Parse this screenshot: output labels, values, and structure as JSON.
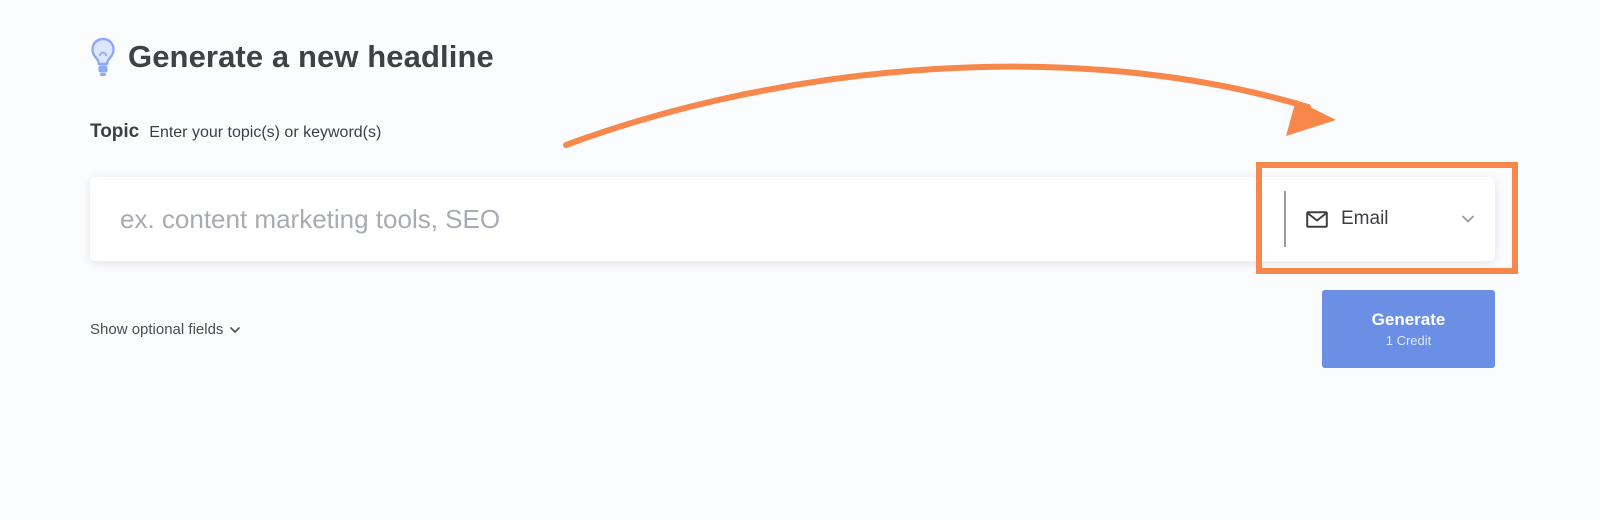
{
  "header": {
    "title": "Generate a new headline",
    "icon": "lightbulb-icon"
  },
  "topic": {
    "label": "Topic",
    "hint": "Enter your topic(s) or keyword(s)",
    "placeholder": "ex. content marketing tools, SEO",
    "value": ""
  },
  "type_select": {
    "icon": "mail-icon",
    "selected": "Email"
  },
  "optional_fields": {
    "label": "Show optional fields"
  },
  "generate": {
    "label": "Generate",
    "sublabel": "1 Credit"
  },
  "colors": {
    "accent": "#6a8fe4",
    "annotation": "#f7874a",
    "bulb": "#8eaaf0",
    "background": "#fbfcfe"
  }
}
